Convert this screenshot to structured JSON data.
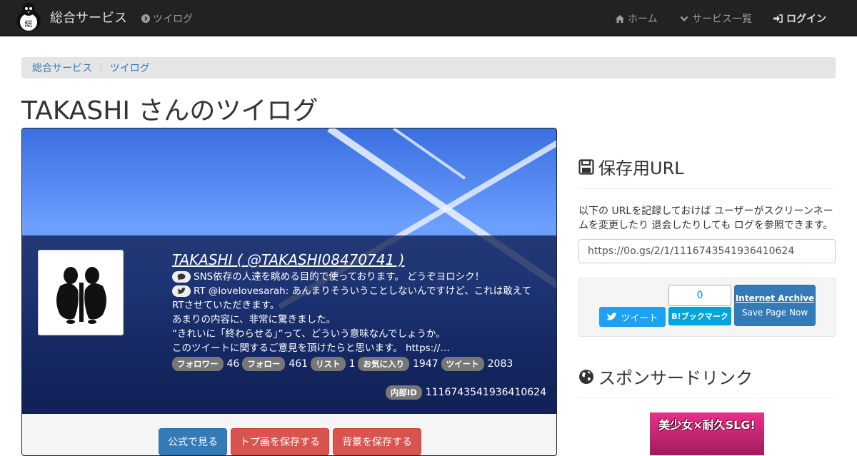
{
  "navbar": {
    "brand_title": "総合サービス",
    "sub_link": "ツイログ",
    "home": "ホーム",
    "services": "サービス一覧",
    "login": "ログイン"
  },
  "breadcrumb": [
    "総合サービス",
    "ツイログ"
  ],
  "page_title": "TAKASHI さんのツイログ",
  "profile": {
    "name": "TAKASHI ( @TAKASHI08470741 )",
    "bio_line1": "SNS依存の人達を眺める目的で使っております。 どうぞヨロシク！",
    "bio_tweet_line1": "RT @lovelovesarah: あんまりそういうことしないんですけど、これは敢えて",
    "bio_tweet_line2": "RTさせていただきます。",
    "bio_tweet_line3": "あまりの内容に、非常に驚きました。",
    "bio_tweet_line4": "”きれいに「終わらせる」”って、どういう意味なんでしょうか。",
    "bio_tweet_line5": "このツイートに関するご意見を頂けたらと思います。 https://…",
    "stats": [
      {
        "label": "フォロワー",
        "value": "46"
      },
      {
        "label": "フォロー",
        "value": "461"
      },
      {
        "label": "リスト",
        "value": "1"
      },
      {
        "label": "お気に入り",
        "value": "1947"
      },
      {
        "label": "ツイート",
        "value": "2083"
      }
    ],
    "internal_label": "内部ID",
    "internal_id": "1116743541936410624"
  },
  "actions": {
    "official": "公式で見る",
    "save_top": "トプ画を保存する",
    "save_bg": "背景を保存する"
  },
  "save_section": {
    "heading": "保存用URL",
    "description": "以下の URLを記録しておけば ユーザーがスクリーンネームを変更したり 退会したりしても ログを参照できます。",
    "url": "https://0o.gs/2/1/1116743541936410624"
  },
  "share": {
    "tweet": "ツイート",
    "hatena_count": "0",
    "hatena": "B!ブックマーク",
    "ia_title": "Internet Archive",
    "ia_sub": "Save Page Now"
  },
  "sponsor": {
    "heading": "スポンサードリンク",
    "ad_text": "美少女×耐久SLG!"
  },
  "colors": {
    "navbar_bg": "#222222",
    "primary": "#337ab7",
    "danger": "#d9534f",
    "twitter": "#1da1f2",
    "hatena": "#00a4de"
  }
}
